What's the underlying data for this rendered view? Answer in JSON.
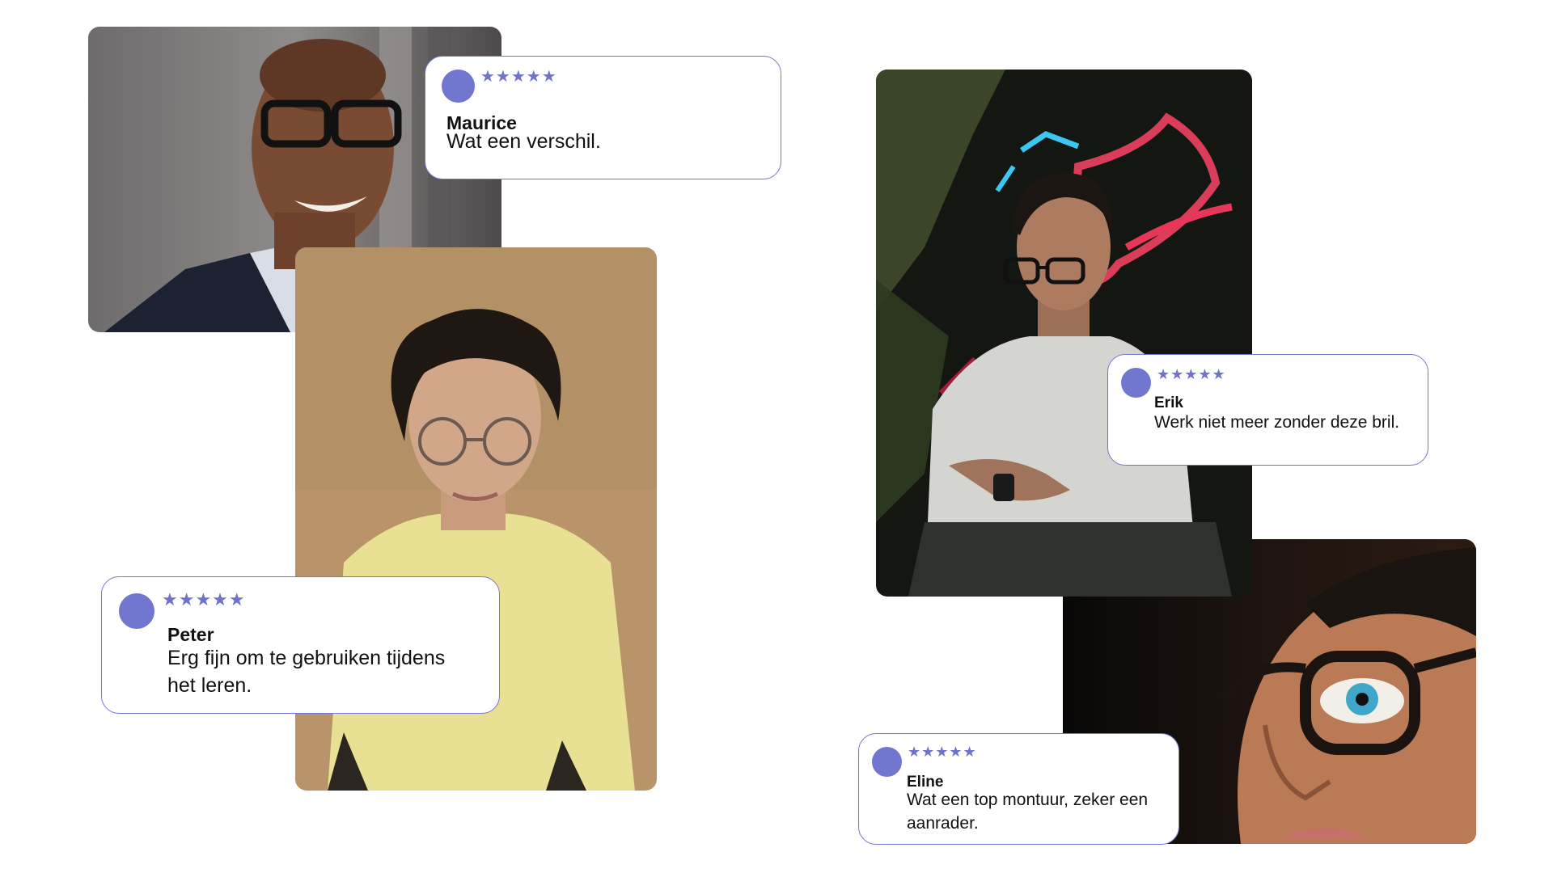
{
  "colors": {
    "accent": "#7176cf",
    "card_border": "#7477cf",
    "star": "#6f73c9",
    "background": "#ffffff"
  },
  "reviews": [
    {
      "name": "Maurice",
      "stars": "★★★★★",
      "rating": 5,
      "text": "Wat een verschil."
    },
    {
      "name": "Peter",
      "stars": "★★★★★",
      "rating": 5,
      "text": "Erg fijn om te gebruiken tijdens het leren."
    },
    {
      "name": "Erik",
      "stars": "★★★★★",
      "rating": 5,
      "text": "Werk niet meer zonder deze bril."
    },
    {
      "name": "Eline",
      "stars": "★★★★★",
      "rating": 5,
      "text": "Wat een top montuur, zeker een aanrader."
    }
  ]
}
